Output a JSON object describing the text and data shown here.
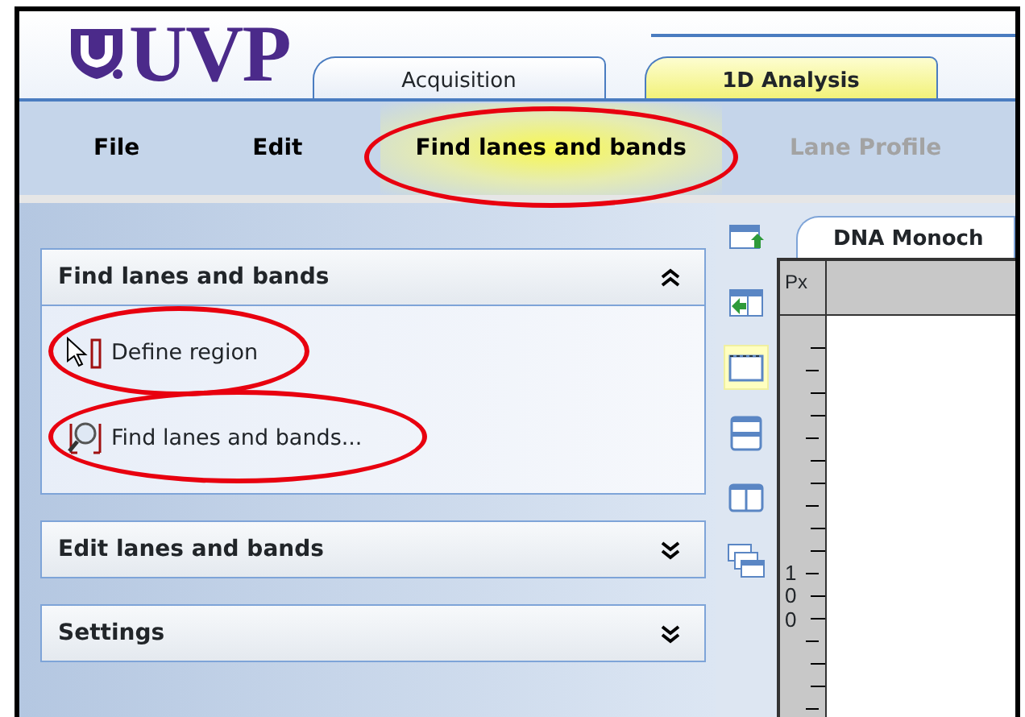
{
  "logo": {
    "text": "UVP"
  },
  "tabs": [
    {
      "label": "Acquisition",
      "selected": false
    },
    {
      "label": "1D Analysis",
      "selected": true
    }
  ],
  "menu": [
    {
      "label": "File",
      "selected": false,
      "disabled": false,
      "circled": false
    },
    {
      "label": "Edit",
      "selected": false,
      "disabled": false,
      "circled": false
    },
    {
      "label": "Find lanes and bands",
      "selected": true,
      "disabled": false,
      "circled": true
    },
    {
      "label": "Lane Profile",
      "selected": false,
      "disabled": true,
      "circled": false
    }
  ],
  "sidebar": {
    "sections": [
      {
        "title": "Find lanes and bands",
        "expanded": true,
        "items": [
          {
            "label": "Define region",
            "kind": "region",
            "circled": true
          },
          {
            "label": "Find lanes and bands...",
            "kind": "find",
            "circled": true
          }
        ]
      },
      {
        "title": "Edit lanes and bands",
        "expanded": false
      },
      {
        "title": "Settings",
        "expanded": false
      }
    ]
  },
  "toolbar": [
    {
      "kind": "up",
      "selected": false
    },
    {
      "kind": "left",
      "selected": false
    },
    {
      "kind": "single",
      "selected": true
    },
    {
      "kind": "rows",
      "selected": false
    },
    {
      "kind": "columns",
      "selected": false
    },
    {
      "kind": "cascade",
      "selected": false
    }
  ],
  "document": {
    "tab": "DNA Monoch",
    "corner": "Px",
    "ruler_label": "100"
  }
}
